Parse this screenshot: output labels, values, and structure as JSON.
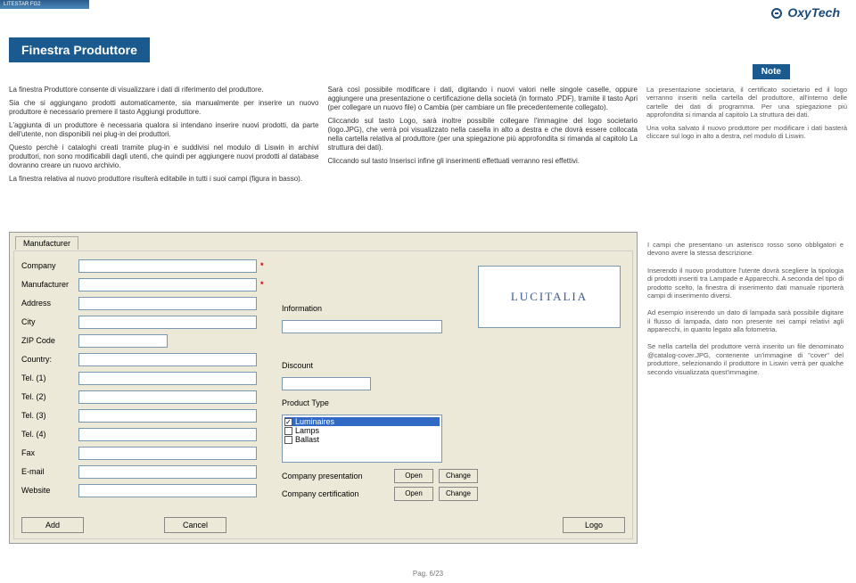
{
  "header": {
    "small_title": "LITESTAR FG2"
  },
  "brand": {
    "name": "OxyTech"
  },
  "page": {
    "title": "Finestra Produttore",
    "note_label": "Note"
  },
  "col1": {
    "p1": "La finestra Produttore consente di visualizzare i dati di riferimento del produttore.",
    "p2": "Sia che si aggiungano prodotti automaticamente, sia manualmente per inserire un nuovo produttore è necessario premere il tasto Aggiungi produttore.",
    "p3": "L'aggiunta di un produttore è necessaria qualora si intendano inserire nuovi prodotti, da parte dell'utente, non disponibili nei plug-in dei produttori.",
    "p4": "Questo perchè i cataloghi creati tramite plug-in e suddivisi nel modulo di Liswin in archivi produttori, non sono modificabili dagli utenti, che quindi per aggiungere nuovi prodotti al database dovranno creare un nuovo archivio.",
    "p5": "La finestra relativa al nuovo produttore risulterà editabile in tutti i suoi campi (figura in basso)."
  },
  "col2": {
    "p1": "Sarà così possibile modificare i dati, digitando i nuovi valori nelle singole caselle, oppure aggiungere una presentazione o certificazione della società (in formato .PDF), tramite il tasto Apri (per collegare un nuovo file) o Cambia (per cambiare un file precedentemente collegato).",
    "p2": "Cliccando sul tasto Logo, sarà inoltre possibile collegare l'immagine del logo societario (logo.JPG), che verrà poi visualizzato nella casella in alto a destra e che dovrà essere collocata nella cartella relativa al produttore (per una spiegazione più approfondita si rimanda al capitolo La struttura dei dati).",
    "p3": "Cliccando sul tasto Inserisci infine gli inserimenti effettuati verranno resi effettivi."
  },
  "col3": {
    "p1": "La presentazione societaria, il certificato societario ed il logo verranno inseriti nella cartella del produttore, all'interno delle cartelle dei dati di programma. Per una spiegazione più approfondita si rimanda al capitolo La struttura dei dati.",
    "p2": "Una volta salvato il nuovo produttore per modificare i dati basterà cliccare sul logo in alto a destra, nel modulo di Liswin."
  },
  "dialog": {
    "tab": "Manufacturer",
    "labels": {
      "company": "Company",
      "manufacturer": "Manufacturer",
      "address": "Address",
      "city": "City",
      "zip": "ZIP Code",
      "country": "Country:",
      "tel1": "Tel. (1)",
      "tel2": "Tel. (2)",
      "tel3": "Tel. (3)",
      "tel4": "Tel. (4)",
      "fax": "Fax",
      "email": "E-mail",
      "website": "Website",
      "information": "Information",
      "discount": "Discount",
      "producttype": "Product Type",
      "presentation": "Company presentation",
      "certification": "Company certification"
    },
    "product_types": {
      "opt1": "Luminaires",
      "opt2": "Lamps",
      "opt3": "Ballast"
    },
    "logo_text": "LUCITALIA",
    "buttons": {
      "open": "Open",
      "change": "Change",
      "add": "Add",
      "cancel": "Cancel",
      "logo": "Logo"
    }
  },
  "right_notes": {
    "p1": "I campi che presentano un asterisco rosso sono obbligatori e devono avere la stessa descrizione.",
    "p2": "Inserendo il nuovo produttore l'utente dovrà scegliere la tipologia di prodotti inseriti tra Lampade e Apparecchi. A seconda del tipo di prodotto scelto, la finestra di inserimento dati manuale riporterà campi di inserimento diversi.",
    "p3": "Ad esempio inserendo un dato di lampada sarà possibile digitare il flusso di lampada, dato non presente nei campi relativi agli apparecchi, in quanto legato alla fotometria.",
    "p4": "Se nella cartella del produttore verrà inserito un file denominato @catalog-cover.JPG, contenente un'immagine di \"cover\" del produttore, selezionando il produttore in Liswin verrà per qualche secondo visualizzata quest'immagine."
  },
  "footer": {
    "page": "Pag. 6/23"
  }
}
